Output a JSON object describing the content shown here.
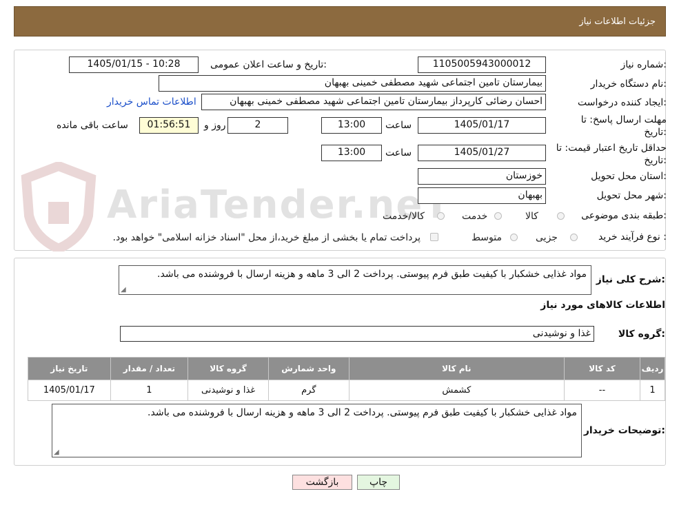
{
  "header": {
    "title": "جزئیات اطلاعات نیاز"
  },
  "watermark": {
    "text": "AriaTender.neT"
  },
  "form": {
    "need_number_label": "شماره نیاز:",
    "need_number": "1105005943000012",
    "announce_label": "تاریخ و ساعت اعلان عمومی:",
    "announce_value": "1405/01/15 - 10:28",
    "buyer_org_label": "نام دستگاه خریدار:",
    "buyer_org": "بیمارستان تامین اجتماعی شهید مصطفی خمینی بهبهان",
    "creator_label": "ایجاد کننده درخواست:",
    "creator": "احسان رضائی کارپرداز بیمارستان تامین اجتماعی شهید مصطفی خمینی بهبهان",
    "contact_link": "اطلاعات تماس خریدار",
    "deadline_label": "مهلت ارسال پاسخ: تا تاریخ:",
    "deadline_date": "1405/01/17",
    "time_label": "ساعت",
    "deadline_time": "13:00",
    "days_value": "2",
    "days_label": "روز و",
    "remaining_time": "01:56:51",
    "remaining_label": "ساعت باقی مانده",
    "validity_label": "حداقل تاریخ اعتبار قیمت: تا تاریخ:",
    "validity_date": "1405/01/27",
    "validity_time": "13:00",
    "province_label": "استان محل تحویل:",
    "province": "خوزستان",
    "city_label": "شهر محل تحویل:",
    "city": "بهبهان",
    "category_label": "طبقه بندی موضوعی:",
    "category_options": [
      "کالا",
      "خدمت",
      "کالا/خدمت"
    ],
    "process_label": "نوع فرآیند خرید :",
    "process_options": [
      "جزیی",
      "متوسط"
    ],
    "payment_note": "پرداخت تمام یا بخشی از مبلغ خرید،از محل \"اسناد خزانه اسلامی\" خواهد بود."
  },
  "summary": {
    "description_label": "شرح کلی نیاز:",
    "description": "مواد غذایی خشکبار با کیفیت طبق فرم پیوستی. پرداخت 2 الی 3 ماهه و هزینه ارسال با فروشنده می باشد.",
    "goods_info_title": "اطلاعات کالاهای مورد نیاز",
    "goods_group_label": "گروه کالا:",
    "goods_group": "غذا و نوشیدنی"
  },
  "table": {
    "headers": [
      "ردیف",
      "کد کالا",
      "نام کالا",
      "واحد شمارش",
      "گروه کالا",
      "تعداد / مقدار",
      "تاریخ نیاز"
    ],
    "rows": [
      [
        "1",
        "--",
        "کشمش",
        "گرم",
        "غذا و نوشیدنی",
        "1",
        "1405/01/17"
      ]
    ]
  },
  "buyer_notes": {
    "label": "توضیحات خریدار:",
    "text": "مواد غذایی خشکبار با کیفیت طبق فرم پیوستی. پرداخت 2 الی 3 ماهه و هزینه ارسال با فروشنده می باشد."
  },
  "buttons": {
    "print": "چاپ",
    "back": "بازگشت"
  },
  "colors": {
    "header_bg": "#8c6a3f",
    "table_header_bg": "#8f8f8f",
    "link": "#1a4ec9",
    "back_bg": "#fde0e0",
    "print_bg": "#e4f6e0"
  }
}
